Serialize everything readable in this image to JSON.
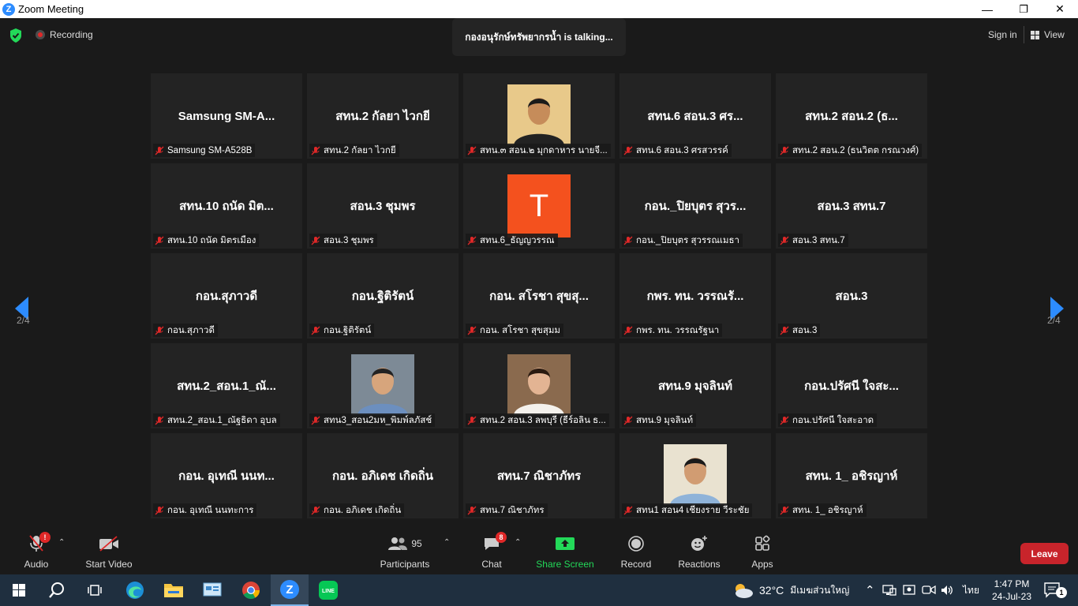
{
  "window": {
    "title": "Zoom Meeting",
    "minimize": "—",
    "maximize": "❐",
    "close": "✕"
  },
  "topbar": {
    "recording_label": "Recording",
    "talking_text": "กองอนุรักษ์ทรัพยากรน้ำ is talking...",
    "signin_label": "Sign in",
    "view_label": "View",
    "security_color": "#23d959"
  },
  "pager": {
    "prev_page": "2/4",
    "next_page": "2/4",
    "arrow_color": "#2d8cff"
  },
  "tiles": [
    {
      "big": "Samsung  SM-A...",
      "name": "Samsung SM-A528B",
      "type": "text"
    },
    {
      "big": "สทน.2 กัลยา ไวกยี",
      "name": "สทน.2 กัลยา ไวกยี",
      "type": "text"
    },
    {
      "big": "",
      "name": "สทน.๓ สอน.๒ มุกดาหาร นายจี...",
      "type": "photo"
    },
    {
      "big": "สทน.6 สอน.3 ศร...",
      "name": "สทน.6 สอน.3 ศรสวรรค์",
      "type": "text"
    },
    {
      "big": "สทน.2 สอน.2 (ธ...",
      "name": "สทน.2 สอน.2 (ธนวิตต กรณวงศ์)",
      "type": "text"
    },
    {
      "big": "สทน.10 ถนัด มิต...",
      "name": "สทน.10 ถนัด มิตรเมือง",
      "type": "text"
    },
    {
      "big": "สอน.3 ชุมพร",
      "name": "สอน.3 ชุมพร",
      "type": "text"
    },
    {
      "big": "T",
      "name": "สทน.6_ธัญญวรรณ",
      "type": "avatar"
    },
    {
      "big": "กอน._ปิยบุตร สุวร...",
      "name": "กอน._ปิยบุตร สุวรรณเมธา",
      "type": "text"
    },
    {
      "big": "สอน.3 สทน.7",
      "name": "สอน.3 สทน.7",
      "type": "text"
    },
    {
      "big": "กอน.สุภาวดี",
      "name": "กอน.สุภาวดี",
      "type": "text"
    },
    {
      "big": "กอน.ฐิติรัตน์",
      "name": "กอน.ฐิติรัตน์",
      "type": "text"
    },
    {
      "big": "กอน. สโรชา สุขสุ...",
      "name": "กอน. สโรชา สุขสุมม",
      "type": "text"
    },
    {
      "big": "กพร. ทน. วรรณรั...",
      "name": "กพร. ทน. วรรณรัฐนา",
      "type": "text"
    },
    {
      "big": "สอน.3",
      "name": "สอน.3",
      "type": "text"
    },
    {
      "big": "สทน.2_สอน.1_ณั...",
      "name": "สทน.2_สอน.1_ณัฐธิดา อุบล",
      "type": "text"
    },
    {
      "big": "",
      "name": "สทน3_สอน2มห_พิมพ์ลภัสช์",
      "type": "photo"
    },
    {
      "big": "",
      "name": "สทน.2 สอน.3 ลพบุรี (ธีร์อลิน ธ...",
      "type": "photo"
    },
    {
      "big": "สทน.9 มุจลินท์",
      "name": "สทน.9 มุจลินท์",
      "type": "text"
    },
    {
      "big": "กอน.ปรัศนี ใจสะ...",
      "name": "กอน.ปรัศนี ใจสะอาด",
      "type": "text"
    },
    {
      "big": "กอน. อุเทณี  นนท...",
      "name": "กอน. อุเทณี  นนทะการ",
      "type": "text"
    },
    {
      "big": "กอน. อภิเดช เกิดถิ่น",
      "name": "กอน. อภิเดช เกิดถิ่น",
      "type": "text"
    },
    {
      "big": "สทน.7 ณิชาภัทร",
      "name": "สทน.7 ณิชาภัทร",
      "type": "text"
    },
    {
      "big": "",
      "name": "สทน1 สอน4 เชียงราย วีระชัย",
      "type": "photo"
    },
    {
      "big": "สทน. 1_ อชิรญาห์",
      "name": "สทน. 1_ อชิรญาห์",
      "type": "text"
    }
  ],
  "toolbar": {
    "audio_label": "Audio",
    "audio_badge": "!",
    "video_label": "Start Video",
    "participants_label": "Participants",
    "participants_count": "95",
    "chat_label": "Chat",
    "chat_badge": "8",
    "share_label": "Share Screen",
    "share_color": "#23d959",
    "record_label": "Record",
    "reactions_label": "Reactions",
    "apps_label": "Apps",
    "leave_label": "Leave",
    "leave_color": "#c8242b"
  },
  "taskbar": {
    "weather_temp": "32°C",
    "weather_text": "มีเมฆส่วนใหญ่",
    "lang": "ไทย",
    "time": "1:47 PM",
    "date": "24-Jul-23",
    "notif_count": "1"
  }
}
